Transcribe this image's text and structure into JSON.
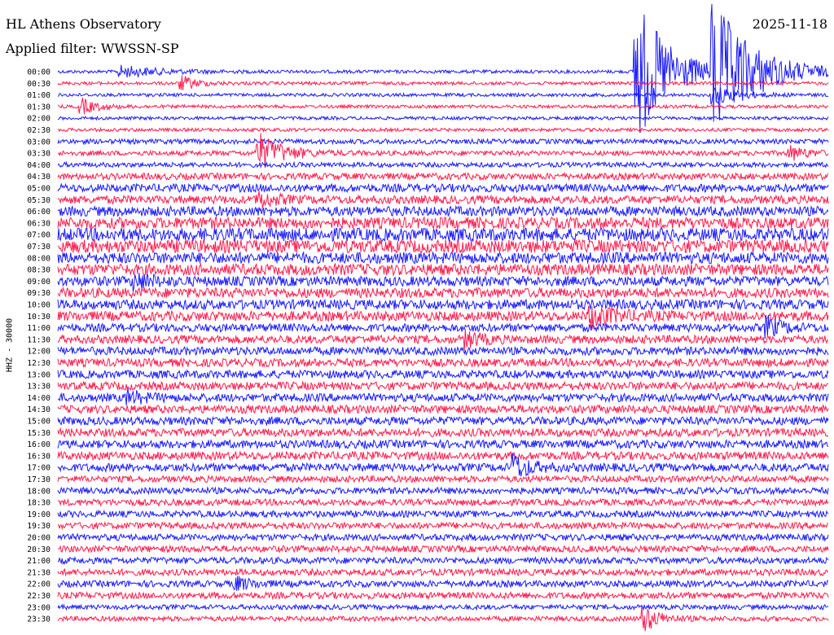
{
  "header": {
    "station": "HL Athens Observatory",
    "filter": "Applied filter: WWSSN-SP",
    "date": "2025-11-18"
  },
  "chart_data": {
    "type": "line",
    "title": "HL Athens Observatory",
    "subtitle": "Applied filter: WWSSN-SP",
    "date": "2025-11-18",
    "ylabel": "HHZ - 30000",
    "row_labels": [
      "00:00",
      "00:30",
      "01:00",
      "01:30",
      "02:00",
      "02:30",
      "03:00",
      "03:30",
      "04:00",
      "04:30",
      "05:00",
      "05:30",
      "06:00",
      "06:30",
      "07:00",
      "07:30",
      "08:00",
      "08:30",
      "09:00",
      "09:30",
      "10:00",
      "10:30",
      "11:00",
      "11:30",
      "12:00",
      "12:30",
      "13:00",
      "13:30",
      "14:00",
      "14:30",
      "15:00",
      "15:30",
      "16:00",
      "16:30",
      "17:00",
      "17:30",
      "18:00",
      "18:30",
      "19:00",
      "19:30",
      "20:00",
      "20:30",
      "21:00",
      "21:30",
      "22:00",
      "22:30",
      "23:00",
      "23:30"
    ],
    "series_colors": [
      "#1a1aff",
      "#ff1a4d"
    ],
    "noise_amplitude_by_row": [
      2,
      2,
      2,
      2,
      2,
      2,
      3,
      3,
      3,
      4,
      5,
      5,
      6,
      7,
      8,
      8,
      7,
      7,
      6,
      6,
      6,
      6,
      5,
      5,
      5,
      5,
      5,
      5,
      5,
      5,
      5,
      5,
      5,
      5,
      5,
      4,
      4,
      4,
      4,
      4,
      4,
      4,
      4,
      4,
      4,
      4,
      3,
      3
    ],
    "events": [
      {
        "row": 0,
        "t": 0.08,
        "amp": 7,
        "dur": 0.05
      },
      {
        "row": 1,
        "t": 0.16,
        "amp": 9,
        "dur": 0.02
      },
      {
        "row": 2,
        "t": 0.85,
        "amp": 12,
        "dur": 0.03
      },
      {
        "row": 3,
        "t": 0.03,
        "amp": 10,
        "dur": 0.02
      },
      {
        "row": 7,
        "t": 0.26,
        "amp": 24,
        "dur": 0.03
      },
      {
        "row": 7,
        "t": 0.95,
        "amp": 9,
        "dur": 0.02
      },
      {
        "row": 11,
        "t": 0.26,
        "amp": 10,
        "dur": 0.02
      },
      {
        "row": 18,
        "t": 0.1,
        "amp": 10,
        "dur": 0.02
      },
      {
        "row": 21,
        "t": 0.69,
        "amp": 14,
        "dur": 0.03
      },
      {
        "row": 22,
        "t": 0.92,
        "amp": 12,
        "dur": 0.02
      },
      {
        "row": 23,
        "t": 0.53,
        "amp": 9,
        "dur": 0.02
      },
      {
        "row": 28,
        "t": 0.09,
        "amp": 8,
        "dur": 0.02
      },
      {
        "row": 34,
        "t": 0.59,
        "amp": 16,
        "dur": 0.02
      },
      {
        "row": 44,
        "t": 0.23,
        "amp": 8,
        "dur": 0.02
      },
      {
        "row": 47,
        "t": 0.76,
        "amp": 16,
        "dur": 0.02
      }
    ],
    "large_events": [
      {
        "row": 0,
        "t": 0.75,
        "amp": 95,
        "dur": 0.04
      },
      {
        "row": 0,
        "t": 0.85,
        "amp": 90,
        "dur": 0.05
      }
    ],
    "xlim": [
      0,
      30
    ],
    "x_units": "minutes per row"
  }
}
